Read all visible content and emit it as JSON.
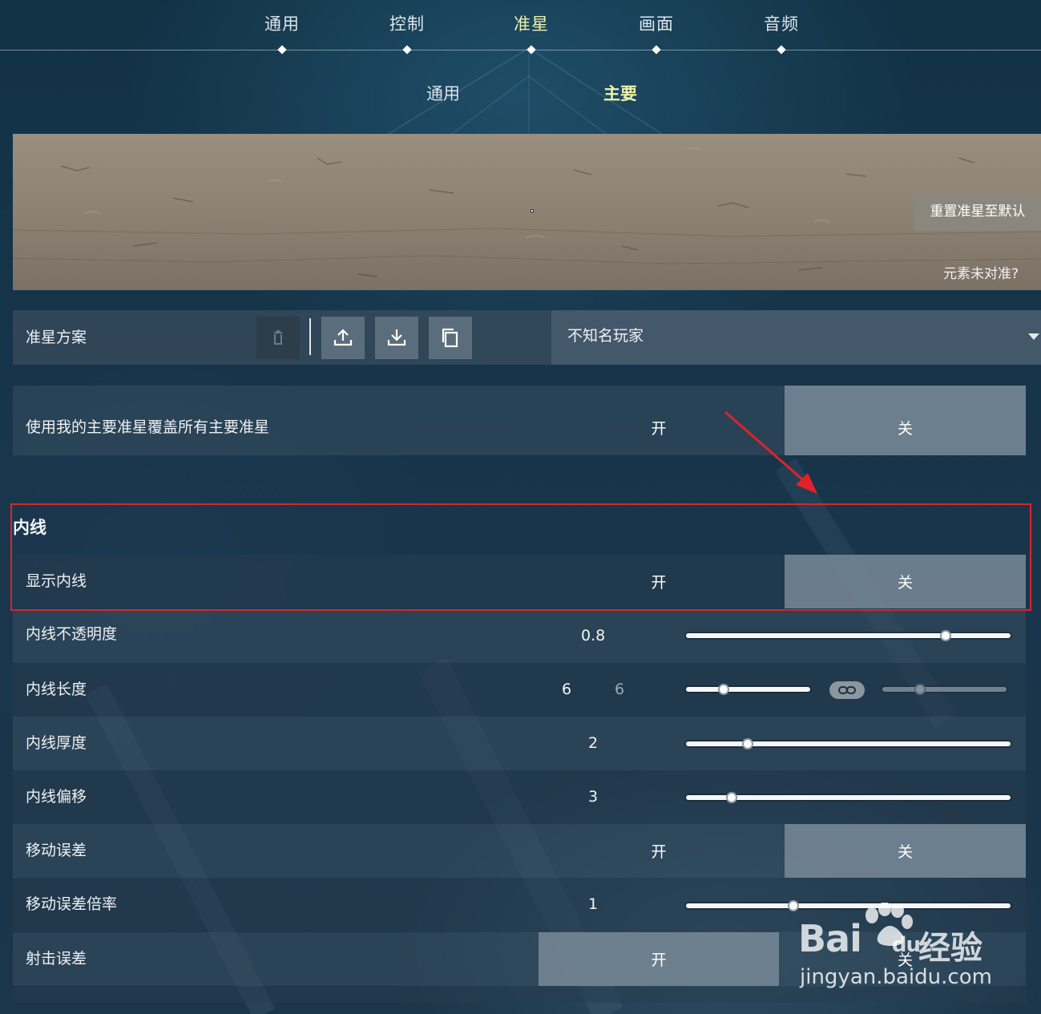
{
  "top_tabs": [
    {
      "label": "通用",
      "active": false
    },
    {
      "label": "控制",
      "active": false
    },
    {
      "label": "准星",
      "active": true
    },
    {
      "label": "画面",
      "active": false
    },
    {
      "label": "音频",
      "active": false
    }
  ],
  "sub_tabs": [
    {
      "label": "通用",
      "active": false
    },
    {
      "label": "主要",
      "active": true
    }
  ],
  "preview": {
    "reset_button": "重置准星至默认",
    "misaligned_link": "元素未对准?"
  },
  "profile": {
    "label": "准星方案",
    "icons": [
      "trash-icon",
      "upload-icon",
      "download-icon",
      "copy-icon"
    ],
    "selected": "不知名玩家"
  },
  "override": {
    "label": "使用我的主要准星覆盖所有主要准星",
    "on": "开",
    "off": "关",
    "selected": "off"
  },
  "inner_lines": {
    "section_title": "内线",
    "show": {
      "label": "显示内线",
      "on": "开",
      "off": "关",
      "selected": "off"
    },
    "opacity": {
      "label": "内线不透明度",
      "value": "0.8",
      "level": 0.8
    },
    "length": {
      "label": "内线长度",
      "value": "6",
      "value2": "6",
      "level": 0.3,
      "level2": 0.3
    },
    "thickness": {
      "label": "内线厚度",
      "value": "2",
      "level": 0.2
    },
    "offset": {
      "label": "内线偏移",
      "value": "3",
      "level": 0.15
    },
    "movement_error": {
      "label": "移动误差",
      "on": "开",
      "off": "关",
      "selected": "off"
    },
    "movement_multiplier": {
      "label": "移动误差倍率",
      "value": "1",
      "level": 0.33
    },
    "firing_error": {
      "label": "射击误差",
      "on": "开",
      "off": "关",
      "selected": "on"
    }
  },
  "watermark": {
    "logo": "Bai",
    "logo_tail": "du",
    "jingyan": "经验",
    "url": "jingyan.baidu.com"
  }
}
